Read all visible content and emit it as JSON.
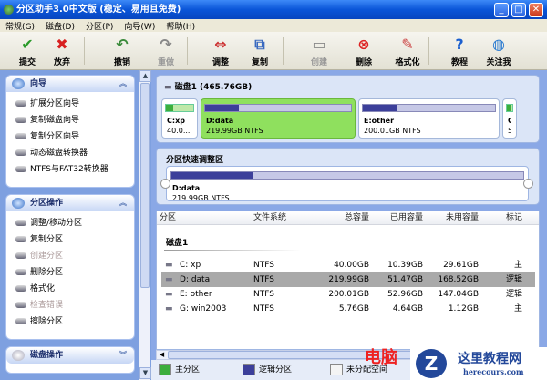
{
  "window": {
    "title": "分区助手3.0中文版 (稳定、易用且免费)",
    "minimize": "_",
    "maximize": "□",
    "close": "✕"
  },
  "menu": [
    "常规(G)",
    "磁盘(D)",
    "分区(P)",
    "向导(W)",
    "帮助(H)"
  ],
  "toolbar": [
    {
      "label": "提交",
      "icon": "check-icon",
      "glyph": "✔",
      "color": "#2a9a2a",
      "enabled": true
    },
    {
      "label": "放弃",
      "icon": "x-icon",
      "glyph": "✖",
      "color": "#d82020",
      "enabled": true
    },
    {
      "label": "撤销",
      "icon": "undo-icon",
      "glyph": "↶",
      "color": "#3a8a3a",
      "enabled": true
    },
    {
      "label": "重做",
      "icon": "redo-icon",
      "glyph": "↷",
      "color": "#888",
      "enabled": false
    },
    {
      "label": "调整",
      "icon": "resize-icon",
      "glyph": "⇔",
      "color": "#c33",
      "enabled": true
    },
    {
      "label": "复制",
      "icon": "copy-icon",
      "glyph": "⧉",
      "color": "#3a6ac0",
      "enabled": true
    },
    {
      "label": "创建",
      "icon": "create-icon",
      "glyph": "▭",
      "color": "#888",
      "enabled": false
    },
    {
      "label": "删除",
      "icon": "delete-icon",
      "glyph": "⊗",
      "color": "#d22",
      "enabled": true
    },
    {
      "label": "格式化",
      "icon": "format-icon",
      "glyph": "✎",
      "color": "#c44",
      "enabled": true
    },
    {
      "label": "教程",
      "icon": "help-icon",
      "glyph": "?",
      "color": "#1b5fcf",
      "enabled": true
    },
    {
      "label": "关注我",
      "icon": "globe-icon",
      "glyph": "◍",
      "color": "#2a7ad0",
      "enabled": true
    }
  ],
  "sidebar": {
    "wizard": {
      "title": "向导",
      "items": [
        "扩展分区向导",
        "复制磁盘向导",
        "复制分区向导",
        "动态磁盘转换器",
        "NTFS与FAT32转换器"
      ]
    },
    "partition_ops": {
      "title": "分区操作",
      "items": [
        {
          "label": "调整/移动分区",
          "enabled": true
        },
        {
          "label": "复制分区",
          "enabled": true
        },
        {
          "label": "创建分区",
          "enabled": false
        },
        {
          "label": "删除分区",
          "enabled": true
        },
        {
          "label": "格式化",
          "enabled": true
        },
        {
          "label": "检查错误",
          "enabled": false
        },
        {
          "label": "擦除分区",
          "enabled": true
        }
      ]
    },
    "disk_ops": {
      "title": "磁盘操作"
    }
  },
  "disk_map": {
    "title": "磁盘1 (465.76GB)",
    "partitions": [
      {
        "name": "C:xp",
        "info": "40.0...",
        "used_pct": 26,
        "type": "primary"
      },
      {
        "name": "D:data",
        "info": "219.99GB NTFS",
        "used_pct": 23,
        "type": "logical",
        "selected": true
      },
      {
        "name": "E:other",
        "info": "200.01GB NTFS",
        "used_pct": 26,
        "type": "logical"
      },
      {
        "name": "G.",
        "info": "5.",
        "used_pct": 80,
        "type": "primary"
      }
    ]
  },
  "quick_adjust": {
    "title": "分区快速调整区",
    "name": "D:data",
    "info": "219.99GB NTFS",
    "used_pct": 23
  },
  "table": {
    "headers": [
      "分区",
      "文件系统",
      "总容量",
      "已用容量",
      "未用容量",
      "标记"
    ],
    "disk_label": "磁盘1",
    "rows": [
      [
        "C:  xp",
        "NTFS",
        "40.00GB",
        "10.39GB",
        "29.61GB",
        "主"
      ],
      [
        "D:  data",
        "NTFS",
        "219.99GB",
        "51.47GB",
        "168.52GB",
        "逻辑"
      ],
      [
        "E:  other",
        "NTFS",
        "200.01GB",
        "52.96GB",
        "147.04GB",
        "逻辑"
      ],
      [
        "G:  win2003",
        "NTFS",
        "5.76GB",
        "4.64GB",
        "1.12GB",
        "主"
      ]
    ],
    "selected_row": 1
  },
  "legend": [
    {
      "label": "主分区",
      "color": "#3cae3c"
    },
    {
      "label": "逻辑分区",
      "color": "#3c3f9a"
    },
    {
      "label": "未分配空间",
      "color": "#f4f4f4"
    }
  ],
  "watermark": {
    "cn": "这里教程网",
    "url": "herecours.com",
    "overlay": "电脑"
  }
}
